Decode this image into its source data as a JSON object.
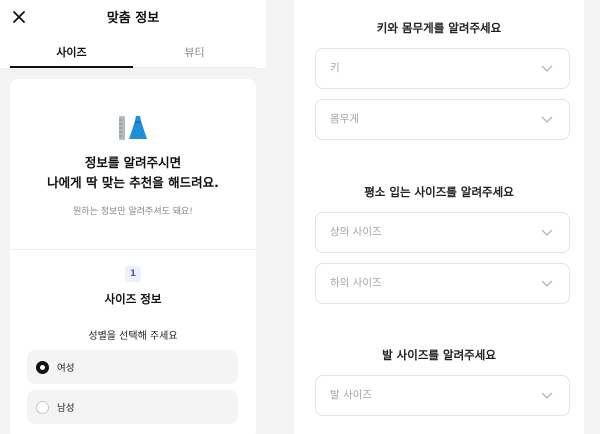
{
  "header": {
    "title": "맞춤 정보",
    "close_icon": "close-icon"
  },
  "tabs": [
    {
      "label": "사이즈",
      "active": true
    },
    {
      "label": "뷰티",
      "active": false
    }
  ],
  "intro": {
    "icon": "clothing-icon",
    "title_line1": "정보를 알려주시면",
    "title_line2": "나에게 딱 맞는 추천을 해드려요.",
    "subtitle": "원하는 정보만 알려주셔도 돼요!"
  },
  "size_step": {
    "number": "1",
    "title": "사이즈 정보",
    "gender_prompt": "성별을 선택해 주세요",
    "options": [
      {
        "label": "여성",
        "selected": true
      },
      {
        "label": "남성",
        "selected": false
      }
    ]
  },
  "body_info": {
    "title": "키와 몸무게를 알려주세요",
    "height_placeholder": "키",
    "weight_placeholder": "몸무게"
  },
  "usual_size": {
    "title": "평소 입는 사이즈를 알려주세요",
    "top_placeholder": "상의 사이즈",
    "bottom_placeholder": "하의 사이즈"
  },
  "shoe_size": {
    "title": "발 사이즈를 알려주세요",
    "placeholder": "발 사이즈"
  },
  "colors": {
    "accent": "#4a5bd3",
    "text": "#111111",
    "placeholder": "#a6a6a6",
    "panel_bg": "#f3f3f4"
  }
}
